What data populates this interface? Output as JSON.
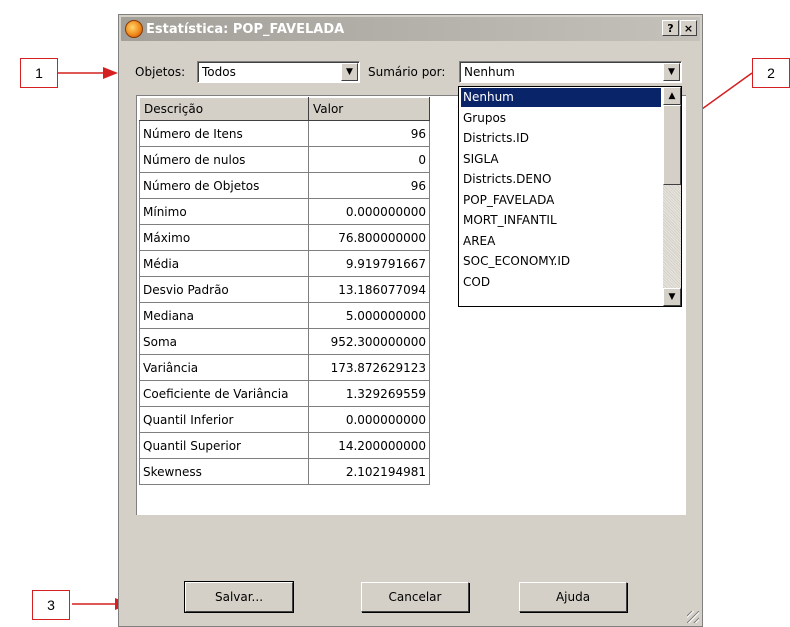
{
  "callouts": {
    "c1": "1",
    "c2": "2",
    "c3": "3"
  },
  "window": {
    "title": "Estatística: POP_FAVELADA",
    "help_btn": "?",
    "close_btn": "×"
  },
  "objetos": {
    "label": "Objetos:",
    "value": "Todos"
  },
  "sumario": {
    "label": "Sumário por:",
    "value": "Nenhum"
  },
  "table": {
    "headers": [
      "Descrição",
      "Valor"
    ],
    "rows": [
      [
        "Número de Itens",
        "96"
      ],
      [
        "Número de nulos",
        "0"
      ],
      [
        "Número de Objetos",
        "96"
      ],
      [
        "Mínimo",
        "0.000000000"
      ],
      [
        "Máximo",
        "76.800000000"
      ],
      [
        "Média",
        "9.919791667"
      ],
      [
        "Desvio Padrão",
        "13.186077094"
      ],
      [
        "Mediana",
        "5.000000000"
      ],
      [
        "Soma",
        "952.300000000"
      ],
      [
        "Variância",
        "173.872629123"
      ],
      [
        "Coeficiente de Variância",
        "1.329269559"
      ],
      [
        "Quantil Inferior",
        "0.000000000"
      ],
      [
        "Quantil Superior",
        "14.200000000"
      ],
      [
        "Skewness",
        "2.102194981"
      ]
    ]
  },
  "dropdown_options": [
    "Nenhum",
    "Grupos",
    "Districts.ID",
    "SIGLA",
    "Districts.DENO",
    "POP_FAVELADA",
    "MORT_INFANTIL",
    "AREA",
    "SOC_ECONOMY.ID",
    "COD"
  ],
  "buttons": {
    "save": "Salvar...",
    "cancel": "Cancelar",
    "help": "Ajuda"
  },
  "colors": {
    "callout_border": "#d42020",
    "selection": "#0a246a",
    "dialog_bg": "#d4d0c8"
  }
}
